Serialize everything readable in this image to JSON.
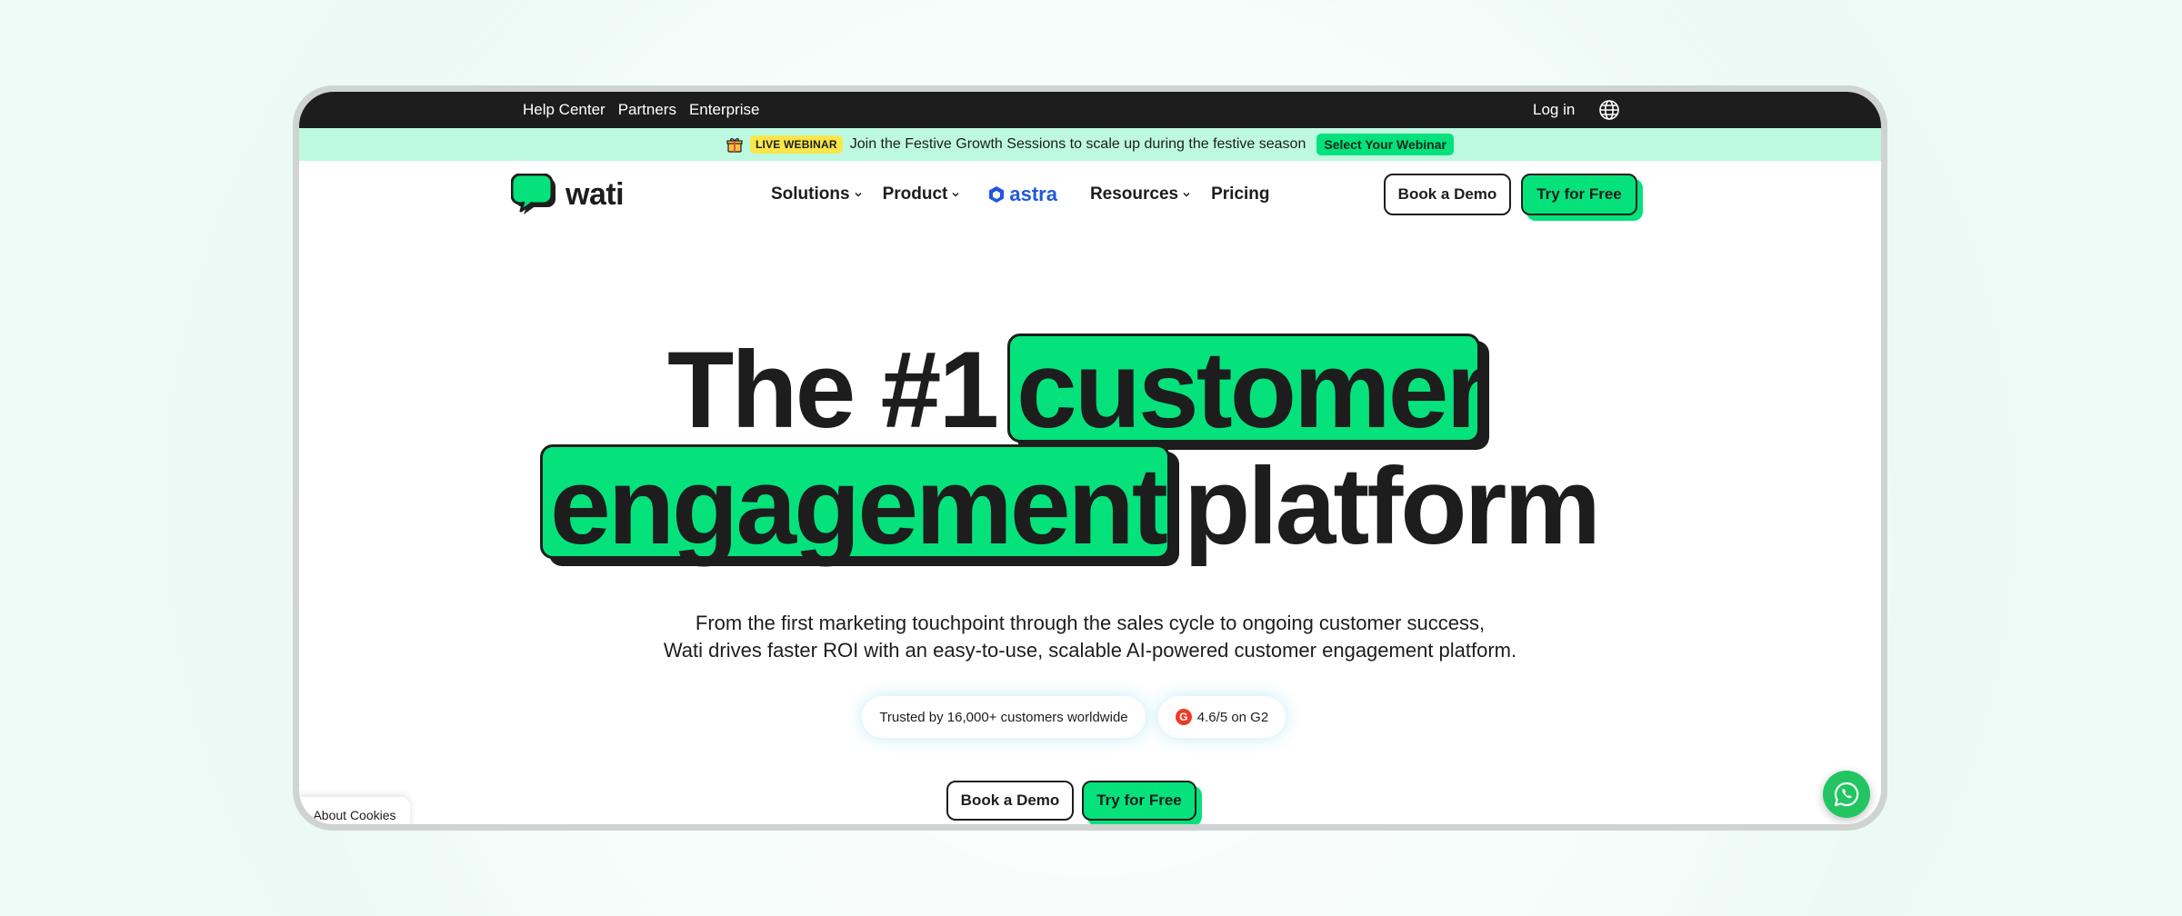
{
  "topbar": {
    "links": [
      "Help Center",
      "Partners",
      "Enterprise"
    ],
    "login": "Log in",
    "language_icon": "globe-icon"
  },
  "announcement": {
    "icon": "gift-icon",
    "badge": "LIVE WEBINAR",
    "text": "Join the Festive Growth Sessions to scale up during the festive season",
    "cta": "Select Your Webinar"
  },
  "nav": {
    "logo": "wati",
    "menu": [
      "Solutions",
      "Product",
      "Resources",
      "Pricing"
    ],
    "astra": "astra",
    "book_demo": "Book a Demo",
    "try_free": "Try for Free"
  },
  "hero": {
    "line1_plain": "The #1",
    "line1_highlight": "customer",
    "line2_highlight": "engagement",
    "line2_plain": "platform",
    "subcopy_line1": "From the first marketing touchpoint through the sales cycle to ongoing customer success,",
    "subcopy_line2": "Wati drives faster ROI with an easy-to-use, scalable AI-powered customer engagement platform.",
    "trust_chip": "Trusted by 16,000+ customers worldwide",
    "rating_chip": "4.6/5 on G2",
    "book_demo": "Book a Demo",
    "try_free": "Try for Free"
  },
  "cookies": "About Cookies",
  "colors": {
    "accent_green": "#05e27c",
    "dark": "#1d1d1d",
    "banner_mint": "#bdf9e0",
    "astra_blue": "#1f57e0"
  }
}
